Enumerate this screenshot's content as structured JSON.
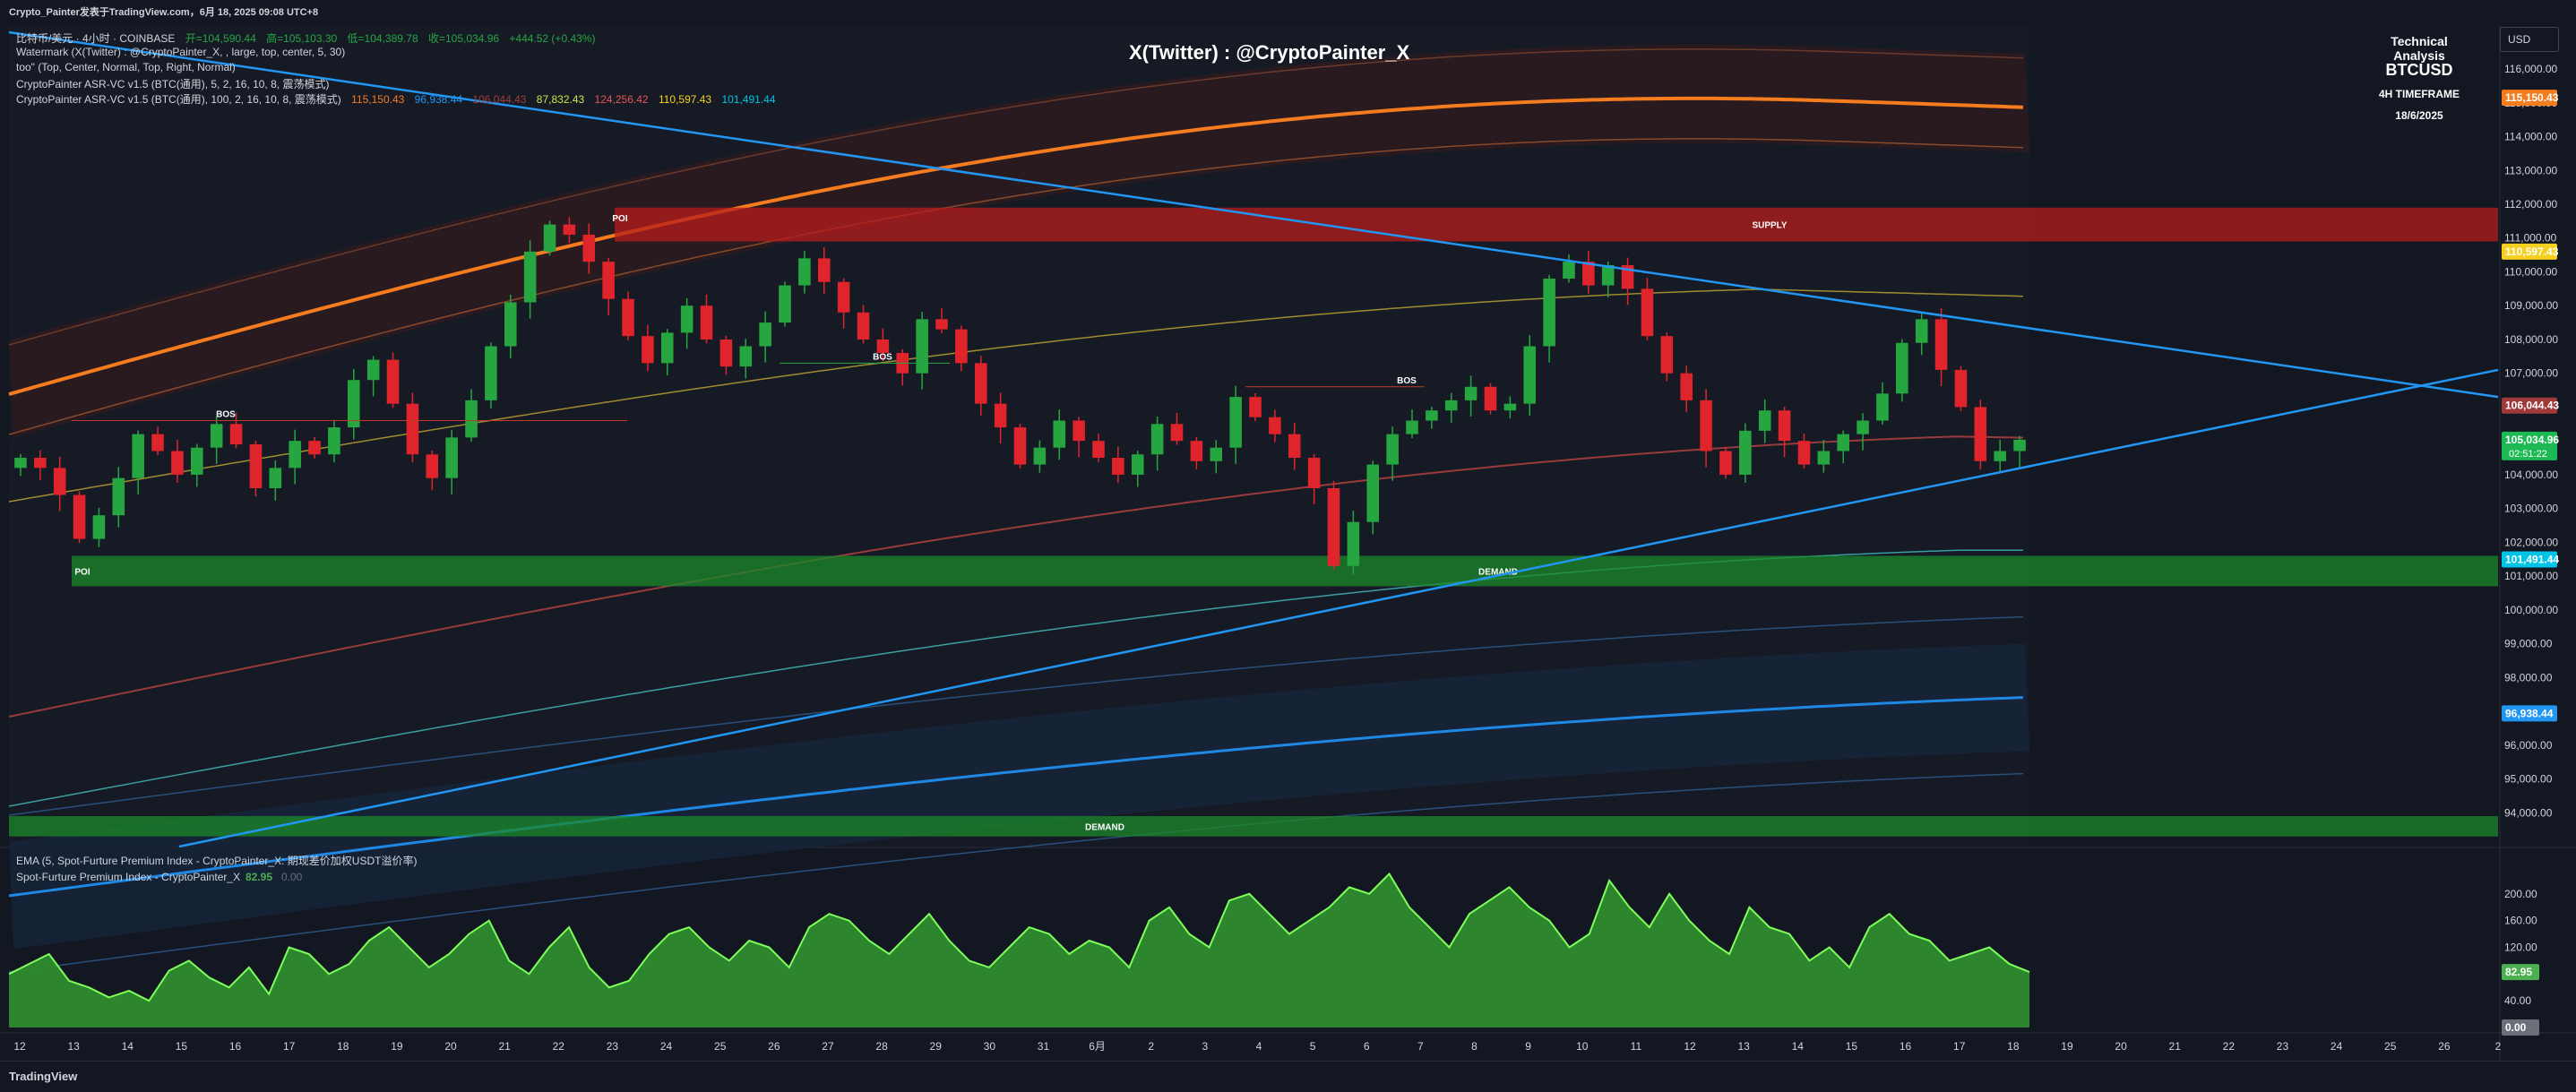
{
  "header": {
    "title": "Crypto_Painter发表于TradingView.com，6月 18, 2025 09:08 UTC+8"
  },
  "legend": {
    "line1": {
      "symbol": "比特币/美元 · 4小时 · COINBASE",
      "open": "开=104,590.44",
      "high": "高=105,103.30",
      "low": "低=104,389.78",
      "close": "收=105,034.96",
      "change": "+444.52 (+0.43%)"
    },
    "line2": "Watermark (X(Twitter) : @CryptoPainter_X, , large, top, center, 5, 30)",
    "line3": "too\" (Top, Center, Normal, Top, Right, Normal)",
    "line4": "CryptoPainter ASR-VC v1.5 (BTC(通用), 5, 2, 16, 10, 8, 震荡模式)",
    "line5": {
      "label": "CryptoPainter ASR-VC v1.5 (BTC(通用), 100, 2, 16, 10, 8, 震荡模式)",
      "values": [
        "115,150.43",
        "96,938.44",
        "106,044.43",
        "87,832.43",
        "124,256.42",
        "110,597.43",
        "101,491.44"
      ]
    }
  },
  "watermark": "X(Twitter) : @CryptoPainter_X",
  "info": {
    "line1": "Technical Analysis",
    "symbol": "BTCUSD",
    "timeframe": "4H TIMEFRAME",
    "date": "18/6/2025"
  },
  "currency": "USD",
  "colors": {
    "up": "#26a641",
    "down": "#e0242b",
    "trend": "#2196f3",
    "orange": "#f57c1f",
    "teal": "#3a9fa0",
    "area": "#2e8b2e",
    "supply": "#b71c1c",
    "demand": "#1b8a2a"
  },
  "bottom": {
    "brand": "TradingView"
  },
  "chart_data": {
    "type": "line",
    "title": "",
    "xlabel": "",
    "ylabel": "",
    "x_ticks": [
      "12",
      "13",
      "14",
      "15",
      "16",
      "17",
      "18",
      "19",
      "20",
      "21",
      "22",
      "23",
      "24",
      "25",
      "26",
      "27",
      "28",
      "29",
      "30",
      "31",
      "6月",
      "2",
      "3",
      "4",
      "5",
      "6",
      "7",
      "8",
      "9",
      "10",
      "11",
      "12",
      "13",
      "14",
      "15",
      "16",
      "17",
      "18",
      "19",
      "20",
      "21",
      "22",
      "23",
      "24",
      "25",
      "26",
      "2"
    ],
    "y_ticks": [
      "116,000.00",
      "115,000.00",
      "114,000.00",
      "113,000.00",
      "112,000.00",
      "111,000.00",
      "110,000.00",
      "109,000.00",
      "108,000.00",
      "107,000.00",
      "106,000.00",
      "105,000.00",
      "104,000.00",
      "103,000.00",
      "102,000.00",
      "101,000.00",
      "100,000.00",
      "99,000.00",
      "98,000.00",
      "97,000.00",
      "96,000.00",
      "95,000.00",
      "94,000.00"
    ],
    "ylim": [
      93000,
      117300
    ],
    "price_labels": [
      {
        "text": "115,150.43",
        "value": 115150.43,
        "color": "#f57c1f"
      },
      {
        "text": "110,597.43",
        "value": 110597.43,
        "color": "#f5d020"
      },
      {
        "text": "106,044.43",
        "value": 106044.43,
        "color": "#a03a3a"
      },
      {
        "text": "105,034.96",
        "value": 105034.96,
        "color": "#1db954",
        "sub": "02:51:22"
      },
      {
        "text": "101,491.44",
        "value": 101491.44,
        "color": "#00c3e8"
      },
      {
        "text": "96,938.44",
        "value": 96938.44,
        "color": "#2196f3"
      }
    ],
    "zones": [
      {
        "label": "SUPPLY",
        "from": 110900,
        "to": 111900
      },
      {
        "label": "POI",
        "from": 100700,
        "to": 101600
      },
      {
        "label": "DEMAND",
        "from": 100700,
        "to": 101600
      },
      {
        "label": "DEMAND",
        "from": 93300,
        "to": 93900
      }
    ],
    "annotations": [
      "POI",
      "BOS",
      "BOS",
      "BOS"
    ],
    "closes": [
      104500,
      104200,
      103400,
      102100,
      102800,
      103900,
      105200,
      104700,
      104000,
      104800,
      105500,
      104900,
      103600,
      104200,
      105000,
      104600,
      105400,
      106800,
      107400,
      106100,
      104600,
      103900,
      105100,
      106200,
      107800,
      109100,
      110600,
      111400,
      111100,
      110300,
      109200,
      108100,
      107300,
      108200,
      109000,
      108000,
      107200,
      107800,
      108500,
      109600,
      110400,
      109700,
      108800,
      108000,
      107600,
      107000,
      108600,
      108300,
      107300,
      106100,
      105400,
      104300,
      104800,
      105600,
      105000,
      104500,
      104000,
      104600,
      105500,
      105000,
      104400,
      104800,
      106300,
      105700,
      105200,
      104500,
      103600,
      101300,
      102600,
      104300,
      105200,
      105600,
      105900,
      106200,
      106600,
      105900,
      106100,
      107800,
      109800,
      110300,
      109600,
      110200,
      109500,
      108100,
      107000,
      106200,
      104700,
      104000,
      105300,
      105900,
      105000,
      104300,
      104700,
      105200,
      105600,
      106400,
      107900,
      108600,
      107100,
      106000,
      104400,
      104700,
      105035
    ],
    "series": [
      {
        "name": "EMA (5, Spot-Furture Premium Index - CryptoPainter_X: 期现差价加权USDT溢价率)",
        "values": []
      },
      {
        "name": "Spot-Furture Premium Index - CryptoPainter_X",
        "last": "82.95",
        "values": [
          80,
          95,
          110,
          70,
          60,
          45,
          55,
          40,
          85,
          100,
          75,
          60,
          90,
          50,
          120,
          110,
          80,
          95,
          130,
          150,
          120,
          90,
          110,
          140,
          160,
          100,
          80,
          120,
          150,
          90,
          60,
          70,
          110,
          140,
          150,
          120,
          100,
          130,
          120,
          90,
          150,
          170,
          160,
          130,
          110,
          140,
          170,
          130,
          100,
          90,
          120,
          150,
          140,
          110,
          130,
          120,
          90,
          160,
          180,
          140,
          120,
          190,
          200,
          170,
          140,
          160,
          180,
          210,
          200,
          230,
          180,
          150,
          120,
          170,
          190,
          210,
          180,
          160,
          120,
          140,
          220,
          180,
          150,
          200,
          160,
          130,
          110,
          180,
          150,
          140,
          100,
          120,
          90,
          150,
          170,
          140,
          130,
          100,
          110,
          120,
          95,
          82.95
        ]
      }
    ],
    "premium_ticks": [
      "200.00",
      "160.00",
      "120.00",
      "80.00",
      "40.00",
      "0.00"
    ],
    "premium_labels": [
      {
        "text": "82.95",
        "color": "#4caf50"
      },
      {
        "text": "0.00",
        "color": "#6b6f7a"
      }
    ]
  }
}
